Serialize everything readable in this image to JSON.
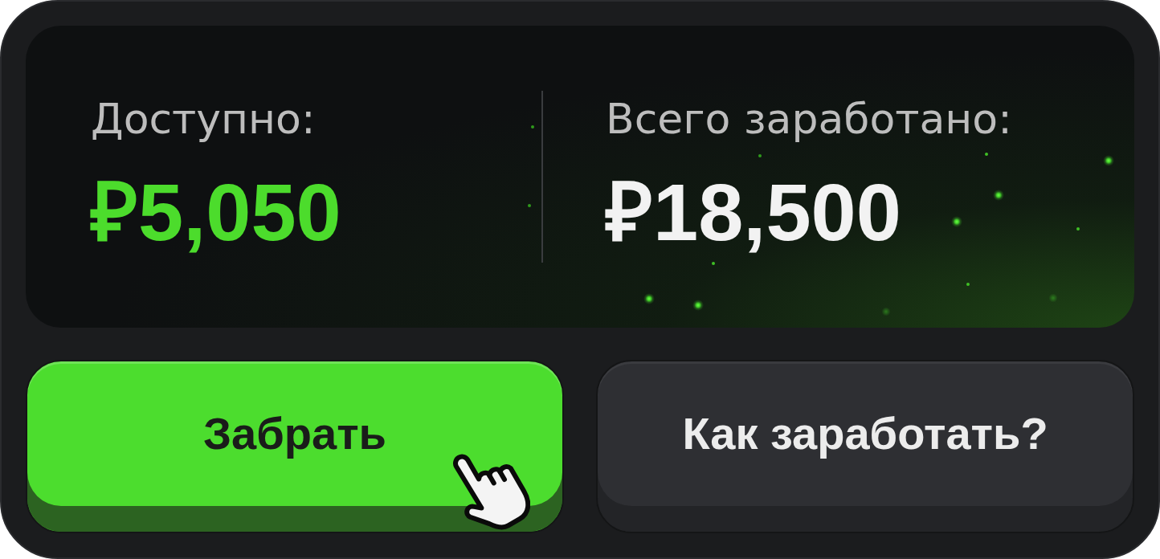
{
  "stats": [
    {
      "kind": "available",
      "label": "Доступно:",
      "value": "₽5,050"
    },
    {
      "kind": "total",
      "label": "Всего заработано:",
      "value": "₽18,500"
    }
  ],
  "buttons": [
    {
      "kind": "primary",
      "label": "Забрать"
    },
    {
      "kind": "secondary",
      "label": "Как заработать?"
    }
  ]
}
